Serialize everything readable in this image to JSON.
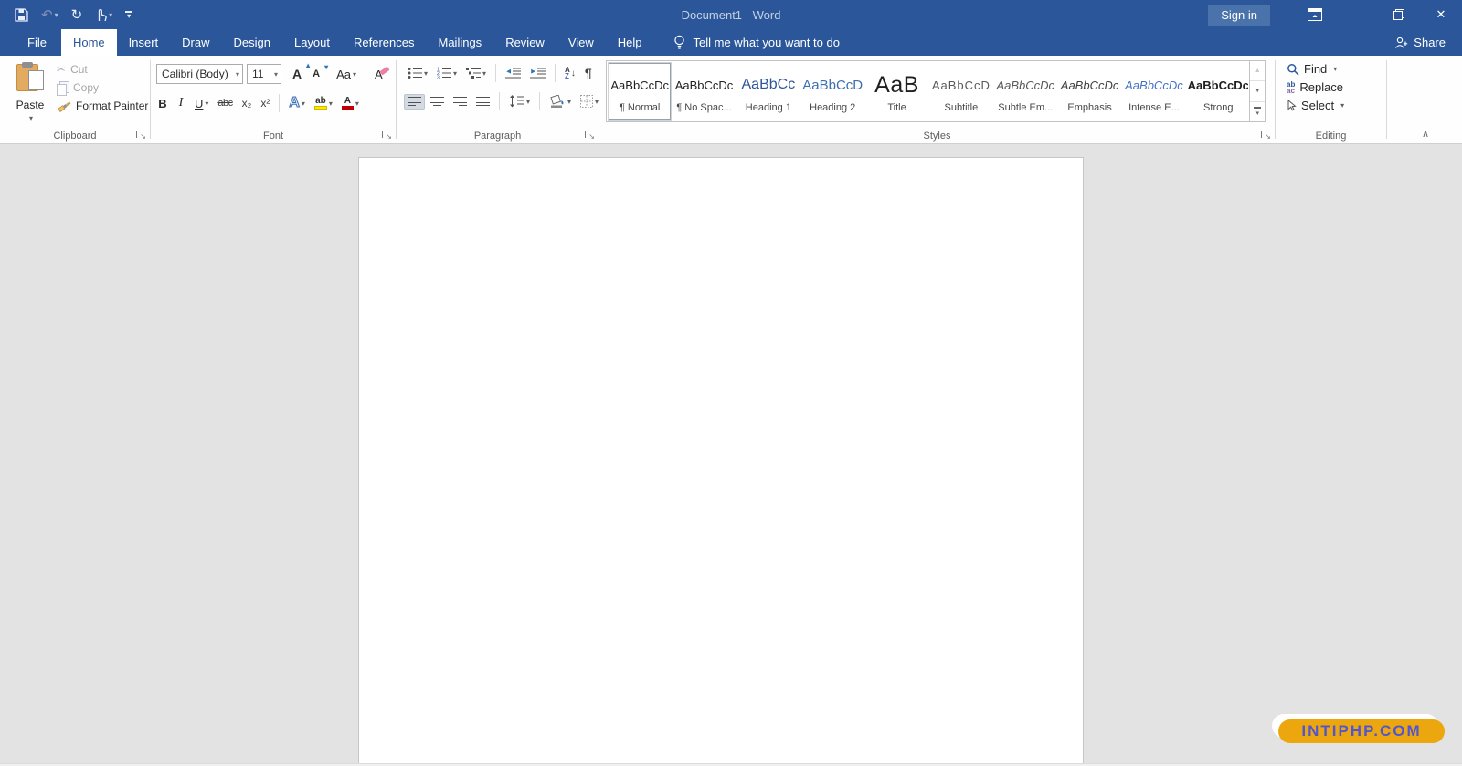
{
  "titlebar": {
    "title": "Document1 - Word",
    "sign_in_label": "Sign in"
  },
  "tabs": [
    {
      "label": "File"
    },
    {
      "label": "Home"
    },
    {
      "label": "Insert"
    },
    {
      "label": "Draw"
    },
    {
      "label": "Design"
    },
    {
      "label": "Layout"
    },
    {
      "label": "References"
    },
    {
      "label": "Mailings"
    },
    {
      "label": "Review"
    },
    {
      "label": "View"
    },
    {
      "label": "Help"
    }
  ],
  "search": {
    "label": "Tell me what you want to do"
  },
  "share": {
    "label": "Share"
  },
  "ribbon": {
    "clipboard": {
      "label": "Clipboard",
      "paste": "Paste",
      "cut": "Cut",
      "copy": "Copy",
      "format_painter": "Format Painter"
    },
    "font": {
      "label": "Font",
      "family": "Calibri (Body)",
      "size": "11",
      "change_case": "Aa",
      "bold": "B",
      "italic": "I",
      "underline": "U",
      "strikethrough": "abc",
      "subscript": "x₂",
      "superscript": "x²",
      "text_effects": "A",
      "highlight": "ab",
      "font_color": "A",
      "clear_formatting": "A"
    },
    "paragraph": {
      "label": "Paragraph",
      "sort_a": "A",
      "sort_z": "Z",
      "pilcrow": "¶"
    },
    "styles": {
      "label": "Styles",
      "items": [
        {
          "preview": "AaBbCcDc",
          "label": "¶ Normal"
        },
        {
          "preview": "AaBbCcDc",
          "label": "¶ No Spac..."
        },
        {
          "preview": "AaBbCc",
          "label": "Heading 1"
        },
        {
          "preview": "AaBbCcD",
          "label": "Heading 2"
        },
        {
          "preview": "AaB",
          "label": "Title"
        },
        {
          "preview": "AaBbCcD",
          "label": "Subtitle"
        },
        {
          "preview": "AaBbCcDc",
          "label": "Subtle Em..."
        },
        {
          "preview": "AaBbCcDc",
          "label": "Emphasis"
        },
        {
          "preview": "AaBbCcDc",
          "label": "Intense E..."
        },
        {
          "preview": "AaBbCcDc",
          "label": "Strong"
        }
      ]
    },
    "editing": {
      "label": "Editing",
      "find": "Find",
      "replace": "Replace",
      "select": "Select",
      "replace_icon": {
        "top": "ab",
        "bottom": "ac"
      }
    }
  },
  "watermark": {
    "text": "INTIPHP.COM"
  },
  "icons": {
    "undo": "↶",
    "redo": "↻",
    "scissors": "✂",
    "caret_down": "▾",
    "caret_up": "▴",
    "close": "✕",
    "minimize": "—",
    "collapse_ribbon": "∧",
    "gallery_up": "▲",
    "gallery_down": "▼",
    "launcher": "↘"
  },
  "colors": {
    "titlebar_bg": "#2b579a",
    "accent": "#2b579a",
    "signin_bg": "#4a73ab",
    "ribbon_bg": "#fefefe",
    "doc_bg": "#e3e3e3",
    "heading1": "#2f5597",
    "heading2": "#3b6fb0",
    "intense": "#4472c4",
    "subtitle": "#595959",
    "highlight_yellow": "#ffe600",
    "font_red": "#c00000",
    "watermark_bg": "#eda70e",
    "watermark_text": "#5156d0"
  }
}
